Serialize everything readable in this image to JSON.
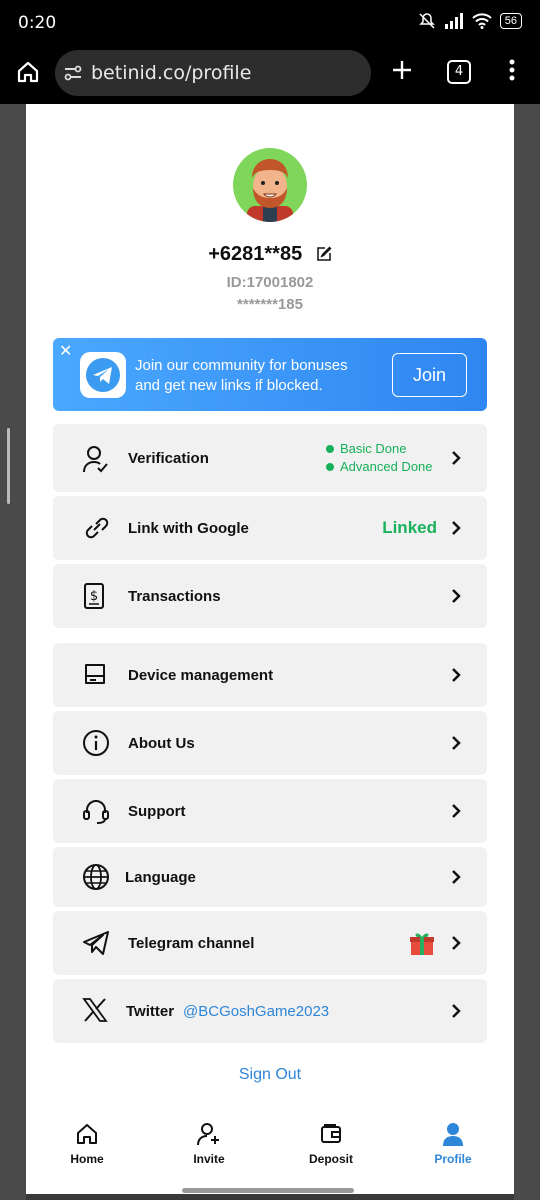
{
  "status": {
    "time": "0:20",
    "battery": "56"
  },
  "browser": {
    "url": "betinid.co/profile",
    "tab_count": "4"
  },
  "profile": {
    "phone": "+6281**85",
    "id": "ID:17001802",
    "masked": "*******185"
  },
  "banner": {
    "line1": "Join our community for bonuses",
    "line2": "and get new links if blocked.",
    "join_label": "Join"
  },
  "menu": {
    "verification": {
      "label": "Verification",
      "basic": "Basic Done",
      "advanced": "Advanced Done"
    },
    "google": {
      "label": "Link with Google",
      "status": "Linked"
    },
    "transactions": {
      "label": "Transactions"
    },
    "device": {
      "label": "Device management"
    },
    "about": {
      "label": "About Us"
    },
    "support": {
      "label": "Support"
    },
    "language": {
      "label": "Language"
    },
    "telegram": {
      "label": "Telegram channel"
    },
    "twitter": {
      "label": "Twitter",
      "handle": "@BCGoshGame2023"
    }
  },
  "sign_out": "Sign Out",
  "nav": {
    "home": "Home",
    "invite": "Invite",
    "deposit": "Deposit",
    "profile": "Profile"
  },
  "colors": {
    "accent": "#2e86d8",
    "success": "#17b15a",
    "banner": "#3d9af8"
  }
}
